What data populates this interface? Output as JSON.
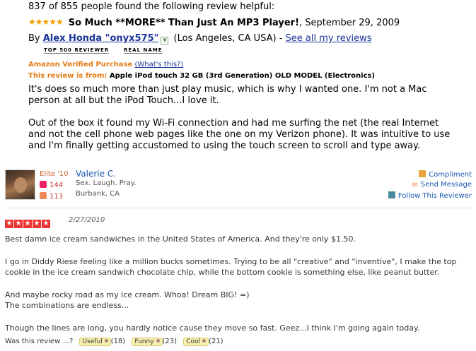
{
  "amazon": {
    "helpful_text": "837 of 855 people found the following review helpful:",
    "title": "So Much **MORE** Than Just An MP3 Player!",
    "date": ", September 29, 2009",
    "rating": 5,
    "by_prefix": "By ",
    "author": "Alex Honda \"onyx575\"",
    "location": " (Los Angeles, CA USA) - ",
    "see_all_link": "See all my reviews",
    "badges": [
      "TOP 500 REVIEWER",
      "REAL NAME"
    ],
    "verified_label": "Amazon Verified Purchase",
    "whats_this": "(What's this?)",
    "review_from_label": "This review is from: ",
    "review_from_product": "Apple iPod touch 32 GB (3rd Generation) OLD MODEL (Electronics)",
    "paragraphs": [
      "It's does so much more than just play music, which is why I wanted one. I'm not a Mac person at all but the iPod Touch...I love it.",
      "Out of the box it found my Wi-Fi connection and had me surfing the net (the real Internet and not the cell phone web pages like the one on my Verizon phone). It was intuitive to use and I'm finally getting accustomed to using the touch screen to scroll and type away."
    ]
  },
  "yelp": {
    "elite": "Elite '10",
    "friends_count": "144",
    "reviews_count": "113",
    "user_name": "Valerie C.",
    "tagline": "Sex.  Laugh.  Pray.",
    "location": "Burbank, CA",
    "actions": [
      "Compliment",
      "Send Message",
      "Follow This Reviewer"
    ],
    "rating": 5,
    "date": "2/27/2010",
    "paragraphs": [
      "Best damn ice cream sandwiches in the United States of America.  And they're only $1.50.",
      "I go in Diddy Riese feeling like a million bucks sometimes.  Trying to be all \"creative\" and \"inventive\", I make the top cookie in the ice cream sandwich chocolate chip, while the bottom cookie is something else, like peanut butter.",
      "And maybe rocky road as my ice cream.  Whoa!  Dream BIG!  =)\nThe combinations are endless...",
      "Though the lines are long, you hardly notice cause they move so fast.  Geez...I think I'm going again today."
    ],
    "vote_prompt": "Was this review ...?",
    "votes": [
      {
        "label": "Useful",
        "count": "(18)"
      },
      {
        "label": "Funny",
        "count": "(23)"
      },
      {
        "label": "Cool",
        "count": "(21)"
      }
    ]
  },
  "colors": {
    "amazon_orange": "#e47911",
    "link_blue": "#1a3399",
    "yelp_red": "#e33333"
  }
}
